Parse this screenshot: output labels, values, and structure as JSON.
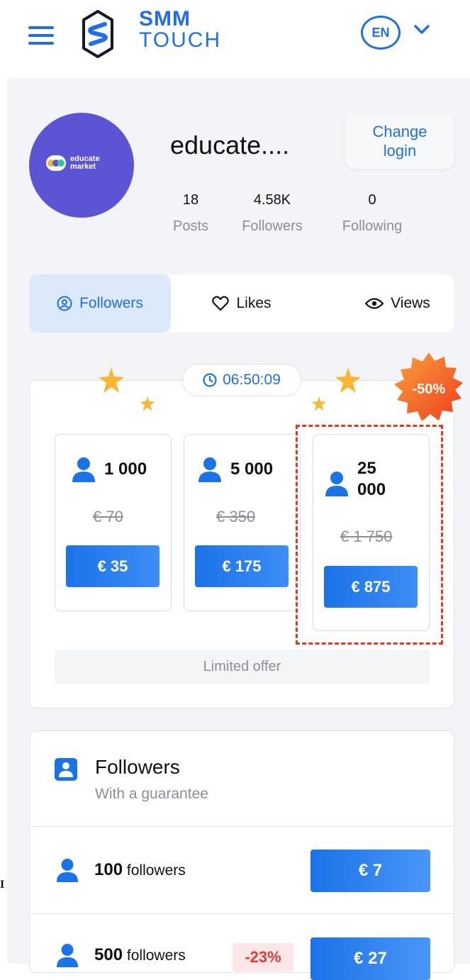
{
  "header": {
    "logo_line1": "SMM",
    "logo_line2": "TOUCH",
    "language": "EN"
  },
  "profile": {
    "username": "educate....",
    "avatar_text_line1": "educate",
    "avatar_text_line2": "market",
    "change_login": "Change login",
    "stats": [
      {
        "value": "18",
        "label": "Posts"
      },
      {
        "value": "4.58K",
        "label": "Followers"
      },
      {
        "value": "0",
        "label": "Following"
      }
    ]
  },
  "tabs": [
    {
      "label": "Followers",
      "icon": "user-circle-icon",
      "active": true
    },
    {
      "label": "Likes",
      "icon": "heart-icon",
      "active": false
    },
    {
      "label": "Views",
      "icon": "eye-icon",
      "active": false
    }
  ],
  "offer": {
    "timer": "06:50:09",
    "discount_badge": "-50%",
    "packages": [
      {
        "amount": "1 000",
        "old_price": "€ 70",
        "price": "€ 35"
      },
      {
        "amount": "5 000",
        "old_price": "€ 350",
        "price": "€ 175"
      },
      {
        "amount_line1": "25",
        "amount_line2": "000",
        "old_price": "€ 1 750",
        "price": "€ 875"
      }
    ],
    "limited": "Limited offer"
  },
  "followers_list": {
    "title": "Followers",
    "subtitle": "With a guarantee",
    "rows": [
      {
        "count": "100",
        "unit": "followers",
        "price": "€ 7",
        "discount": ""
      },
      {
        "count": "500",
        "unit": "followers",
        "price": "€ 27",
        "discount": "-23%"
      }
    ]
  },
  "stray_text": "I",
  "colors": {
    "brand_blue": "#1f6fe8",
    "badge_orange": "#f0501e",
    "star_yellow": "#f7b733",
    "discount_red": "#e53935"
  }
}
